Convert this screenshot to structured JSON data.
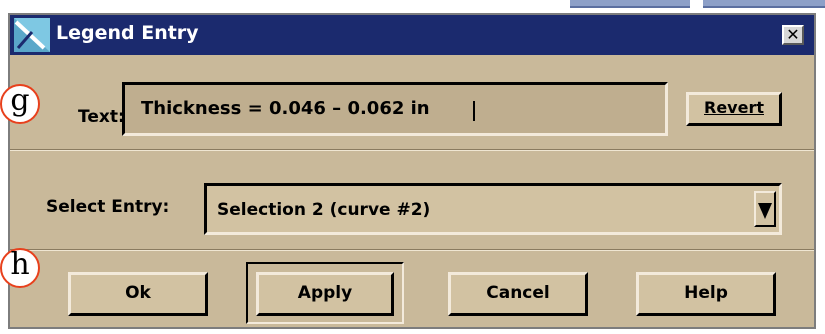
{
  "window": {
    "title": "Legend Entry",
    "close_glyph": "✕",
    "title_icon": "legend-entry-app-icon",
    "titlebar_color": "#1b2a6e",
    "body_color": "#c9b99a"
  },
  "text_row": {
    "label": "Text:",
    "value": "Thickness = 0.046 – 0.062 in",
    "revert_label": "Revert"
  },
  "select_row": {
    "label": "Select Entry:",
    "value": "Selection 2 (curve #2)",
    "dropdown_icon": "triangle-down-icon"
  },
  "buttons": {
    "ok": "Ok",
    "apply": "Apply",
    "cancel": "Cancel",
    "help": "Help"
  },
  "markers": {
    "g": "g",
    "h": "h",
    "color": "#e8401c"
  }
}
